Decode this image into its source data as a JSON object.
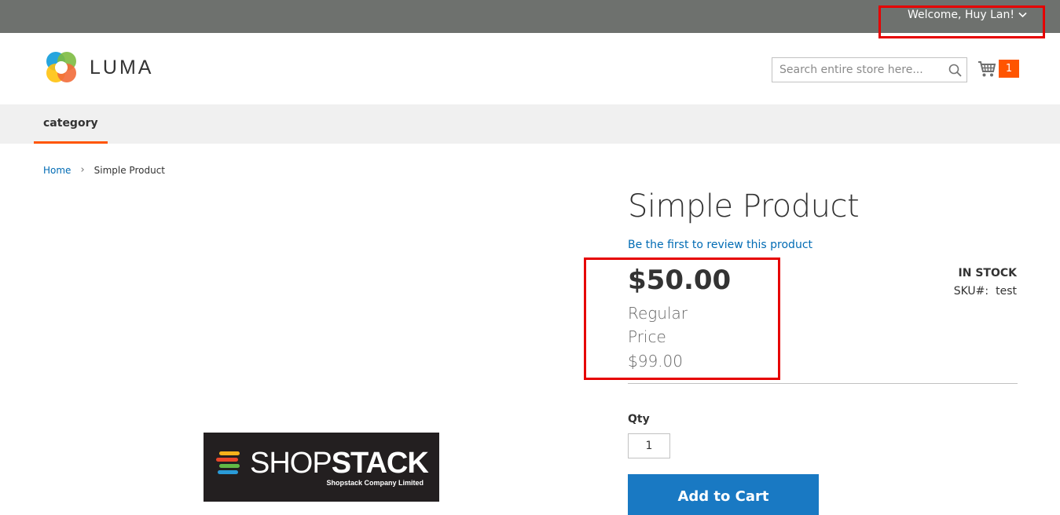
{
  "topbar": {
    "welcome_text": "Welcome, Huy Lan!",
    "background_color": "#6e716e"
  },
  "header": {
    "logo_text": "LUMA",
    "search_placeholder": "Search entire store here...",
    "search_icon": "search-icon",
    "cart_icon": "cart-icon",
    "cart_count": "1",
    "accent_color": "#ff5501"
  },
  "nav": {
    "items": [
      {
        "label": "category"
      }
    ]
  },
  "breadcrumb": {
    "home": "Home",
    "separator": "›",
    "current": "Simple Product"
  },
  "product": {
    "title": "Simple Product",
    "review_link": "Be the first to review this product",
    "final_price": "$50.00",
    "regular_price_label": "Regular Price",
    "regular_price": "$99.00",
    "stock_status": "IN STOCK",
    "sku_label": "SKU#:",
    "sku_value": "test",
    "qty_label": "Qty",
    "qty_value": "1",
    "add_to_cart_label": "Add to Cart",
    "button_color": "#1979c3"
  },
  "product_image": {
    "brand_light": "SHOP",
    "brand_bold": "STACK",
    "subtitle": "Shopstack Company Limited"
  }
}
